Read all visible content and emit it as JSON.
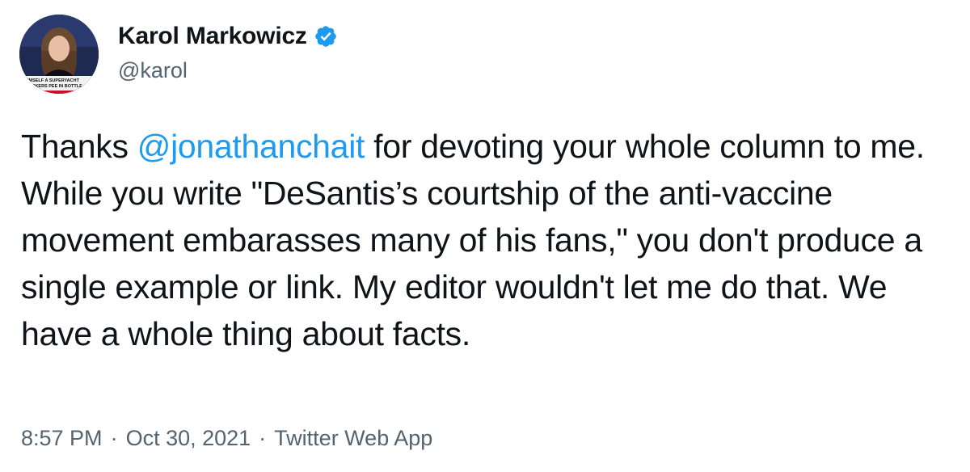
{
  "author": {
    "display_name": "Karol Markowicz",
    "handle": "@karol",
    "verified": true,
    "avatar_caption_lines": [
      "HIMSELF A SUPERYACHT",
      "WORKERS PEE IN BOTTLE"
    ]
  },
  "tweet": {
    "text_before_mention": "Thanks ",
    "mention": "@jonathanchait",
    "text_after_mention": " for devoting your whole column to me. While you write \"DeSantis’s courtship of the anti-vaccine movement embarasses many of his fans,\" you don't produce a single example or link. My editor wouldn't let me do that. We have a whole thing about facts."
  },
  "meta": {
    "time": "8:57 PM",
    "separator1": "·",
    "date": "Oct 30, 2021",
    "separator2": "·",
    "source": "Twitter Web App"
  },
  "colors": {
    "text": "#0f1419",
    "secondary": "#536471",
    "accent": "#1d9bf0"
  },
  "icons": {
    "verified": "verified-badge-icon"
  }
}
